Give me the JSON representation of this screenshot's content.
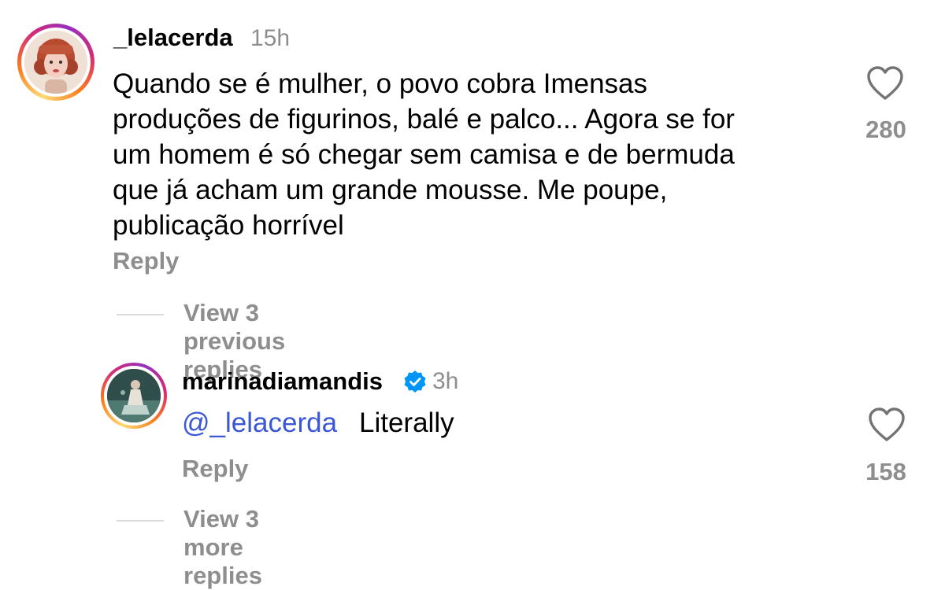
{
  "comment": {
    "username": "_lelacerda",
    "time": "15h",
    "text": "Quando se é mulher, o povo cobra Imensas\nproduções de figurinos, balé e palco... Agora se for\num homem é só chegar sem camisa e de bermuda\nque já acham um grande mousse. Me poupe,\npublicação horrível",
    "reply_label": "Reply",
    "likes": "280",
    "like_icon": "heart-outline-icon",
    "view_previous_label": "View 3 previous replies"
  },
  "reply": {
    "username": "marinadiamandis",
    "verified_icon": "verified-badge-icon",
    "time": "3h",
    "mention": "@_lelacerda",
    "text": "Literally",
    "reply_label": "Reply",
    "likes": "158",
    "like_icon": "heart-outline-icon",
    "view_more_label": "View 3 more replies"
  },
  "colors": {
    "text_primary": "#000000",
    "text_secondary": "#8e8e8e",
    "mention": "#3a57d6",
    "verified": "#0095f6",
    "divider": "#dbdbdb"
  }
}
